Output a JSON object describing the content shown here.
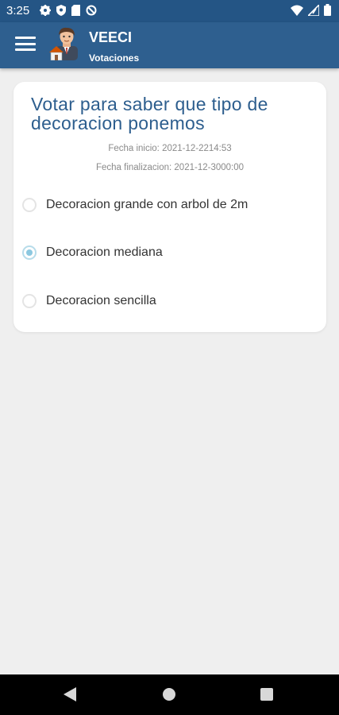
{
  "status_bar": {
    "time": "3:25",
    "left_icons": [
      "gear-icon",
      "shield-icon",
      "sd-card-icon",
      "no-sync-icon"
    ],
    "right_icons": [
      "wifi-icon",
      "signal-icon",
      "battery-icon"
    ]
  },
  "app_bar": {
    "title": "VEECI",
    "subtitle": "Votaciones",
    "color": "#2e5f8f"
  },
  "poll": {
    "title": "Votar para saber que tipo de decoracion ponemos",
    "start_date": "Fecha inicio: 2021-12-2214:53",
    "end_date": "Fecha finalizacion: 2021-12-3000:00",
    "options": [
      {
        "label": "Decoracion grande con arbol de 2m",
        "selected": false
      },
      {
        "label": "Decoracion mediana",
        "selected": true
      },
      {
        "label": "Decoracion sencilla",
        "selected": false
      }
    ]
  },
  "nav_bar": {
    "buttons": [
      "back-icon",
      "home-icon",
      "recents-icon"
    ]
  }
}
